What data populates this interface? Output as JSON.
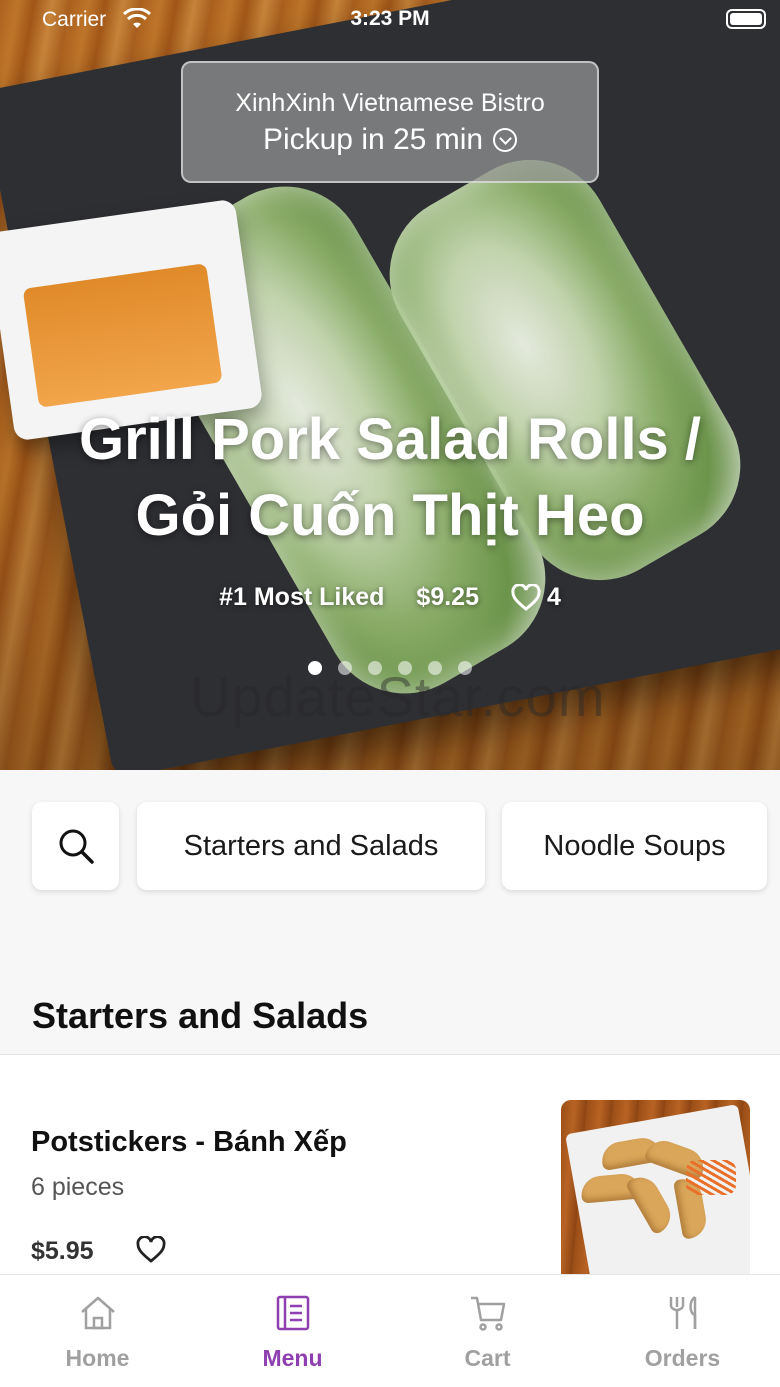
{
  "status_bar": {
    "carrier": "Carrier",
    "time": "3:23 PM"
  },
  "header": {
    "restaurant_name": "XinhXinh Vietnamese Bistro",
    "pickup_text": "Pickup in 25 min"
  },
  "hero": {
    "title_line1": "Grill Pork Salad Rolls /",
    "title_line2": "Gỏi Cuốn Thịt Heo",
    "rank_label": "#1 Most Liked",
    "price": "$9.25",
    "likes": "4",
    "carousel_page_count": 6,
    "carousel_active_index": 0,
    "watermark": "UpdateStar.com"
  },
  "categories": {
    "items": [
      "Starters and Salads",
      "Noodle Soups"
    ]
  },
  "section": {
    "title": "Starters and Salads"
  },
  "menu_items": [
    {
      "name": "Potstickers - Bánh  Xếp",
      "description": "6 pieces",
      "price": "$5.95"
    }
  ],
  "tab_bar": {
    "tabs": [
      {
        "label": "Home",
        "icon": "home-icon"
      },
      {
        "label": "Menu",
        "icon": "menu-icon"
      },
      {
        "label": "Cart",
        "icon": "cart-icon"
      },
      {
        "label": "Orders",
        "icon": "orders-icon"
      }
    ],
    "active_index": 1
  },
  "colors": {
    "accent": "#8e3fb0",
    "inactive": "#a0a0a0"
  }
}
